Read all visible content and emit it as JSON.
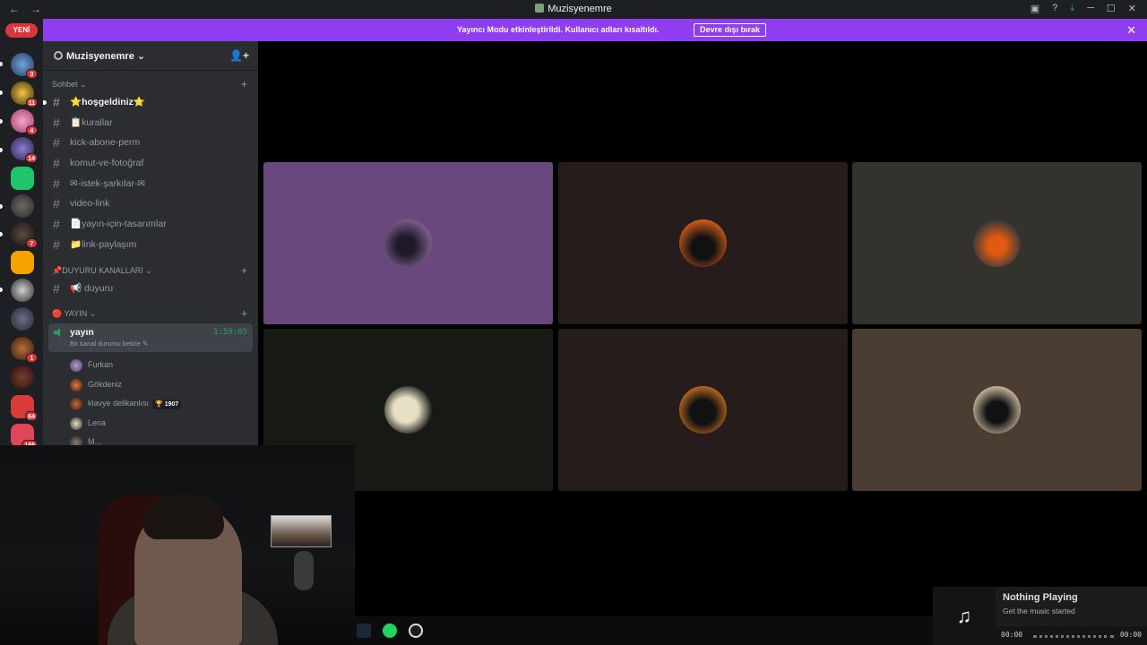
{
  "titlebar": {
    "title": "Muzisyenemre"
  },
  "guilds": {
    "new_badge": "YENİ",
    "badges": [
      "3",
      "11",
      "4",
      "14",
      "7",
      "1",
      "64",
      "166"
    ]
  },
  "banner": {
    "message": "Yayıncı Modu etkinleştirildi. Kullanıcı adları kısaltıldı.",
    "button": "Devre dışı bırak"
  },
  "server": {
    "name": "Muzisyenemre",
    "categories": [
      {
        "name": "Sohbet"
      },
      {
        "name": "📌DUYURU KANALLARI"
      },
      {
        "name": "🔴 YAYIN"
      }
    ],
    "chat_channels": [
      "⭐hoşgeldiniz⭐",
      "📋kurallar",
      "kick-abone-perm",
      "komut-ve-fotoğraf",
      "✉-istek-şarkılar-✉",
      "video-link",
      "📄yayın-için-tasarımlar",
      "📁link-paylaşım"
    ],
    "announce_channels": [
      "📢 duyuru"
    ],
    "voice_channel": {
      "name": "yayın",
      "time": "1:59:05",
      "status": "Bir kanal durumu belirle"
    },
    "members": [
      {
        "name": "Furkan"
      },
      {
        "name": "Gökdeniz"
      },
      {
        "name": "klavye delikanlısı",
        "tag": "🏆 1907"
      },
      {
        "name": "Lena"
      },
      {
        "name": "M..."
      }
    ]
  },
  "music": {
    "title": "Nothing Playing",
    "subtitle": "Get the music started",
    "elapsed": "00:00",
    "total": "00:00"
  }
}
